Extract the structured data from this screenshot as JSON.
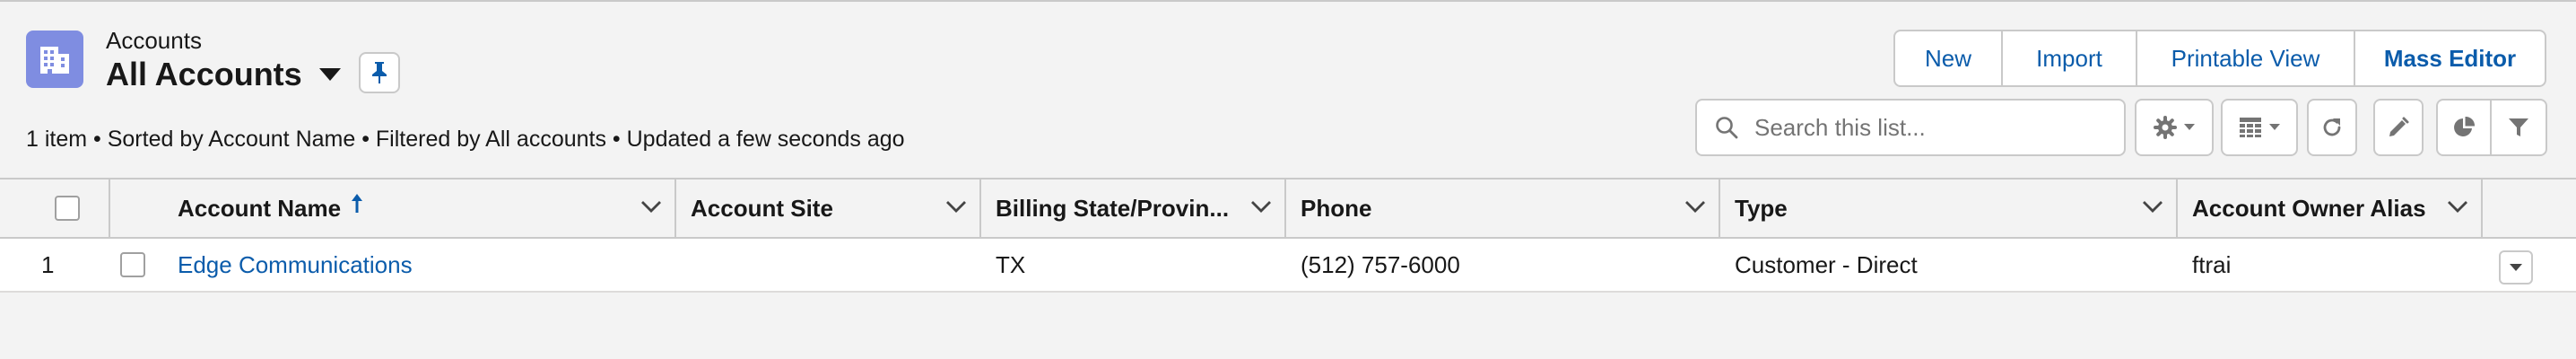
{
  "header": {
    "object_label": "Accounts",
    "list_view_title": "All Accounts",
    "summary": "1 item • Sorted by Account Name • Filtered by All accounts • Updated a few seconds ago"
  },
  "actions": [
    "New",
    "Import",
    "Printable View",
    "Mass Editor"
  ],
  "search": {
    "placeholder": "Search this list...",
    "value": ""
  },
  "toolbar_icons": [
    "gear-icon",
    "table-icon",
    "refresh-icon",
    "pencil-icon",
    "pie-chart-icon",
    "filter-icon"
  ],
  "table": {
    "columns": [
      "Account Name",
      "Account Site",
      "Billing State/Provin...",
      "Phone",
      "Type",
      "Account Owner Alias"
    ],
    "sorted_column": "Account Name",
    "sort_direction": "ascending",
    "rows": [
      {
        "row_number": "1",
        "account_name": "Edge Communications",
        "account_site": "",
        "billing_state": "TX",
        "phone": "(512) 757-6000",
        "type": "Customer - Direct",
        "owner_alias": "ftrai"
      }
    ]
  },
  "colors": {
    "brand_link": "#0b5cab",
    "object_icon": "#7f8de1",
    "border": "#c9c9c9",
    "background": "#f3f3f3"
  }
}
